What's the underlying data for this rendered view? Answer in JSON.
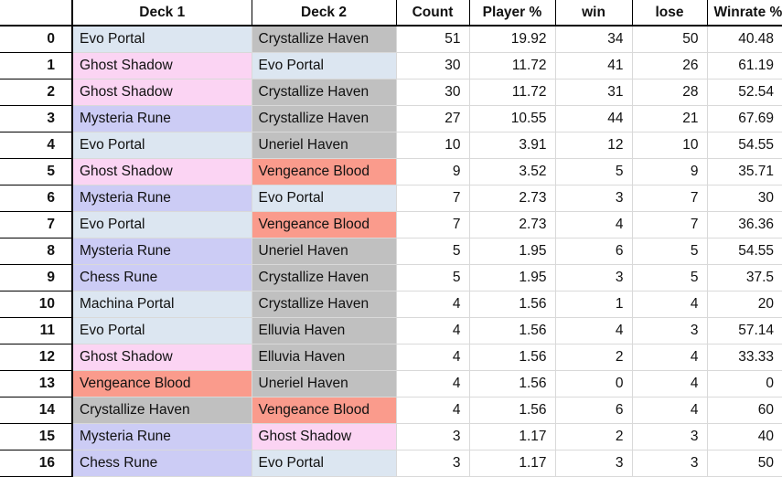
{
  "table": {
    "columns": [
      {
        "key": "index",
        "label": ""
      },
      {
        "key": "deck1",
        "label": "Deck 1"
      },
      {
        "key": "deck2",
        "label": "Deck 2"
      },
      {
        "key": "count",
        "label": "Count"
      },
      {
        "key": "player",
        "label": "Player %"
      },
      {
        "key": "win",
        "label": "win"
      },
      {
        "key": "lose",
        "label": "lose"
      },
      {
        "key": "winrate",
        "label": "Winrate %"
      }
    ],
    "archetype_colors": {
      "portal": "#dce6f1",
      "shadow": "#fbd4f3",
      "rune": "#ccccf5",
      "haven": "#c0c0c0",
      "blood": "#fa9b8c"
    },
    "rows": [
      {
        "index": "0",
        "deck1": "Evo Portal",
        "deck1_tint": "portal",
        "deck2": "Crystallize Haven",
        "deck2_tint": "haven",
        "count": "51",
        "player": "19.92",
        "win": "34",
        "lose": "50",
        "winrate": "40.48"
      },
      {
        "index": "1",
        "deck1": "Ghost Shadow",
        "deck1_tint": "shadow",
        "deck2": "Evo Portal",
        "deck2_tint": "portal",
        "count": "30",
        "player": "11.72",
        "win": "41",
        "lose": "26",
        "winrate": "61.19"
      },
      {
        "index": "2",
        "deck1": "Ghost Shadow",
        "deck1_tint": "shadow",
        "deck2": "Crystallize Haven",
        "deck2_tint": "haven",
        "count": "30",
        "player": "11.72",
        "win": "31",
        "lose": "28",
        "winrate": "52.54"
      },
      {
        "index": "3",
        "deck1": "Mysteria Rune",
        "deck1_tint": "rune",
        "deck2": "Crystallize Haven",
        "deck2_tint": "haven",
        "count": "27",
        "player": "10.55",
        "win": "44",
        "lose": "21",
        "winrate": "67.69"
      },
      {
        "index": "4",
        "deck1": "Evo Portal",
        "deck1_tint": "portal",
        "deck2": "Uneriel Haven",
        "deck2_tint": "haven",
        "count": "10",
        "player": "3.91",
        "win": "12",
        "lose": "10",
        "winrate": "54.55"
      },
      {
        "index": "5",
        "deck1": "Ghost Shadow",
        "deck1_tint": "shadow",
        "deck2": "Vengeance Blood",
        "deck2_tint": "blood",
        "count": "9",
        "player": "3.52",
        "win": "5",
        "lose": "9",
        "winrate": "35.71"
      },
      {
        "index": "6",
        "deck1": "Mysteria Rune",
        "deck1_tint": "rune",
        "deck2": "Evo Portal",
        "deck2_tint": "portal",
        "count": "7",
        "player": "2.73",
        "win": "3",
        "lose": "7",
        "winrate": "30"
      },
      {
        "index": "7",
        "deck1": "Evo Portal",
        "deck1_tint": "portal",
        "deck2": "Vengeance Blood",
        "deck2_tint": "blood",
        "count": "7",
        "player": "2.73",
        "win": "4",
        "lose": "7",
        "winrate": "36.36"
      },
      {
        "index": "8",
        "deck1": "Mysteria Rune",
        "deck1_tint": "rune",
        "deck2": "Uneriel Haven",
        "deck2_tint": "haven",
        "count": "5",
        "player": "1.95",
        "win": "6",
        "lose": "5",
        "winrate": "54.55"
      },
      {
        "index": "9",
        "deck1": "Chess Rune",
        "deck1_tint": "rune",
        "deck2": "Crystallize Haven",
        "deck2_tint": "haven",
        "count": "5",
        "player": "1.95",
        "win": "3",
        "lose": "5",
        "winrate": "37.5"
      },
      {
        "index": "10",
        "deck1": "Machina Portal",
        "deck1_tint": "portal",
        "deck2": "Crystallize Haven",
        "deck2_tint": "haven",
        "count": "4",
        "player": "1.56",
        "win": "1",
        "lose": "4",
        "winrate": "20"
      },
      {
        "index": "11",
        "deck1": "Evo Portal",
        "deck1_tint": "portal",
        "deck2": "Elluvia Haven",
        "deck2_tint": "haven",
        "count": "4",
        "player": "1.56",
        "win": "4",
        "lose": "3",
        "winrate": "57.14"
      },
      {
        "index": "12",
        "deck1": "Ghost Shadow",
        "deck1_tint": "shadow",
        "deck2": "Elluvia Haven",
        "deck2_tint": "haven",
        "count": "4",
        "player": "1.56",
        "win": "2",
        "lose": "4",
        "winrate": "33.33"
      },
      {
        "index": "13",
        "deck1": "Vengeance Blood",
        "deck1_tint": "blood",
        "deck2": "Uneriel Haven",
        "deck2_tint": "haven",
        "count": "4",
        "player": "1.56",
        "win": "0",
        "lose": "4",
        "winrate": "0"
      },
      {
        "index": "14",
        "deck1": "Crystallize Haven",
        "deck1_tint": "haven",
        "deck2": "Vengeance Blood",
        "deck2_tint": "blood",
        "count": "4",
        "player": "1.56",
        "win": "6",
        "lose": "4",
        "winrate": "60"
      },
      {
        "index": "15",
        "deck1": "Mysteria Rune",
        "deck1_tint": "rune",
        "deck2": "Ghost Shadow",
        "deck2_tint": "shadow",
        "count": "3",
        "player": "1.17",
        "win": "2",
        "lose": "3",
        "winrate": "40"
      },
      {
        "index": "16",
        "deck1": "Chess Rune",
        "deck1_tint": "rune",
        "deck2": "Evo Portal",
        "deck2_tint": "portal",
        "count": "3",
        "player": "1.17",
        "win": "3",
        "lose": "3",
        "winrate": "50"
      }
    ]
  }
}
